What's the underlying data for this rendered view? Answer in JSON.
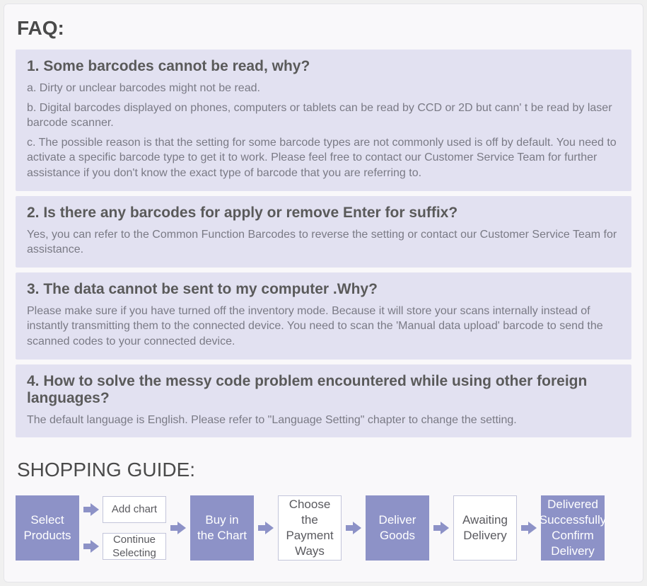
{
  "faq": {
    "title": "FAQ:",
    "items": [
      {
        "q": "1. Some barcodes cannot be read, why?",
        "a": [
          "a. Dirty or unclear barcodes might not be read.",
          "b. Digital barcodes displayed on phones, computers or tablets can be read by CCD or 2D but cann' t  be read by laser barcode scanner.",
          "c. The possible reason is that the setting for some barcode types are not commonly used is off by default. You need to activate a specific barcode type to get it to work. Please feel free to contact our Customer Service Team for further assistance if you don't know the exact type of barcode that you are referring to."
        ]
      },
      {
        "q": "2. Is there any barcodes for apply or remove Enter for suffix?",
        "a": [
          "Yes, you can refer to the Common Function Barcodes to reverse the setting or contact our Customer Service Team for assistance."
        ]
      },
      {
        "q": "3. The data cannot be sent to my computer .Why?",
        "a": [
          "Please make sure if you have turned off the inventory mode. Because it will store your scans internally instead of instantly transmitting them to the connected device. You need to scan the  'Manual data upload' barcode to send the scanned codes to your connected device."
        ]
      },
      {
        "q": "4. How to solve the messy code problem encountered while using other foreign languages?",
        "a": [
          "The default language is English. Please refer to  \"Language Setting\"  chapter to change the setting."
        ]
      }
    ]
  },
  "guide": {
    "title": "SHOPPING GUIDE:",
    "steps": {
      "select": "Select Products",
      "add": "Add chart",
      "continue": "Continue Selecting",
      "buy": "Buy in the Chart",
      "payment": "Choose the Payment Ways",
      "deliver": "Deliver Goods",
      "awaiting": "Awaiting Delivery",
      "confirm": "Delivered Successfully Confirm Delivery"
    }
  }
}
